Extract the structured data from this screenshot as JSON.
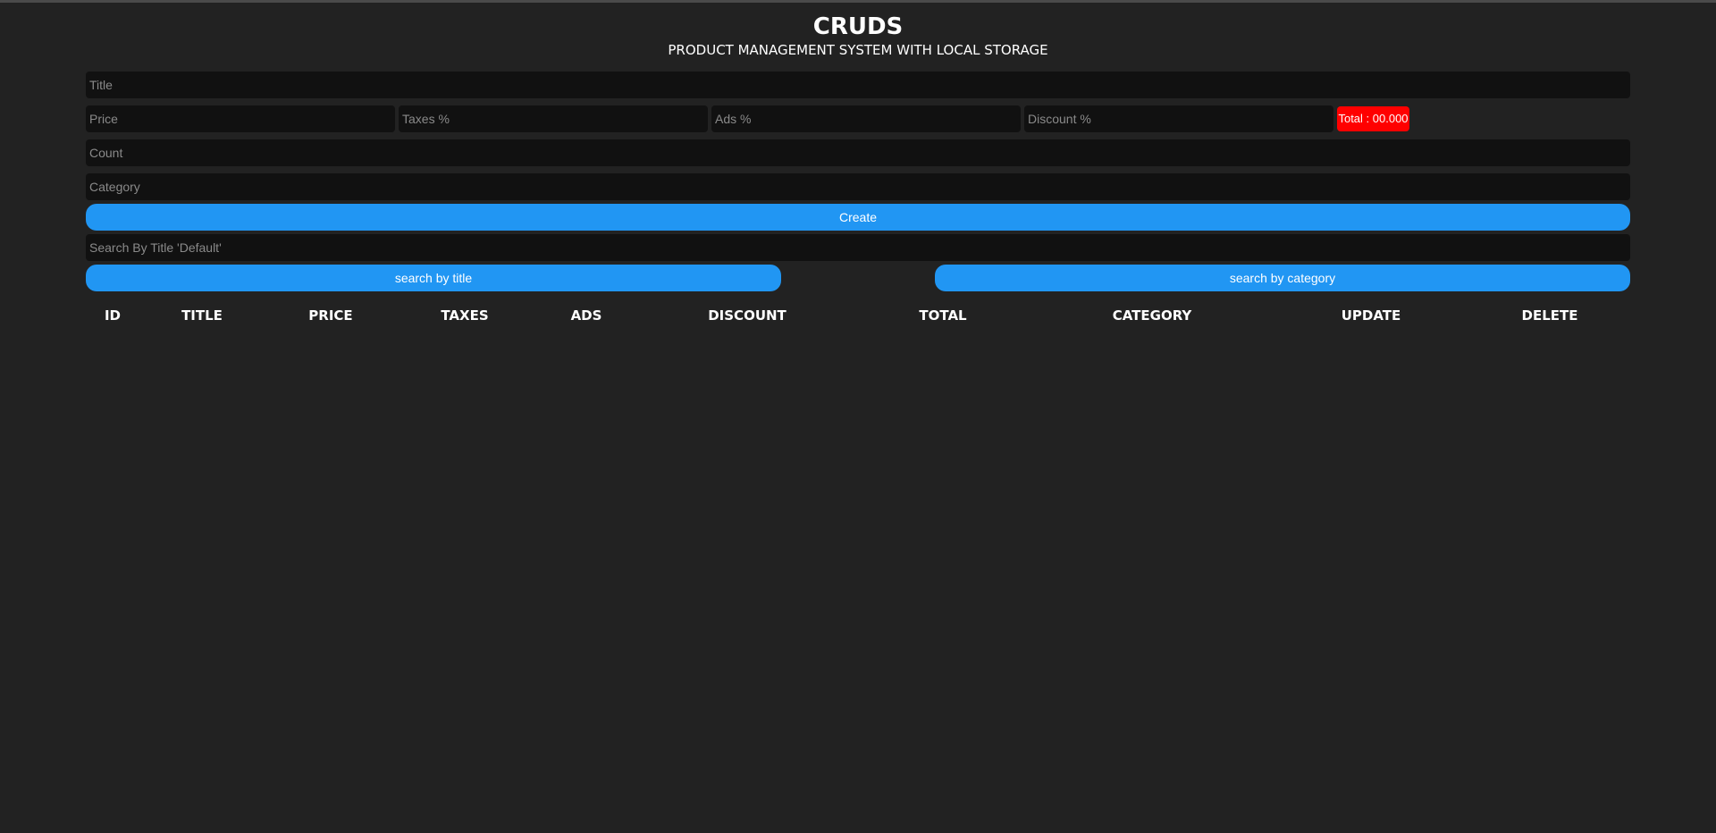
{
  "header": {
    "title": "CRUDS",
    "subtitle": "PRODUCT MANAGEMENT SYSTEM WITH LOCAL STORAGE"
  },
  "form": {
    "title_placeholder": "Title",
    "price_placeholder": "Price",
    "taxes_placeholder": "Taxes %",
    "ads_placeholder": "Ads %",
    "discount_placeholder": "Discount %",
    "total_label": "Total : 00.000",
    "count_placeholder": "Count",
    "category_placeholder": "Category",
    "create_label": "Create"
  },
  "search": {
    "placeholder": "Search By Title 'Default'",
    "by_title_label": "search by title",
    "by_category_label": "search by category"
  },
  "table": {
    "columns": [
      "ID",
      "TITLE",
      "PRICE",
      "TAXES",
      "ADS",
      "DISCOUNT",
      "TOTAL",
      "CATEGORY",
      "UPDATE",
      "DELETE"
    ]
  },
  "colors": {
    "background": "#222222",
    "input_background": "#111111",
    "accent": "#2196f3",
    "total_badge": "#ff0000"
  }
}
